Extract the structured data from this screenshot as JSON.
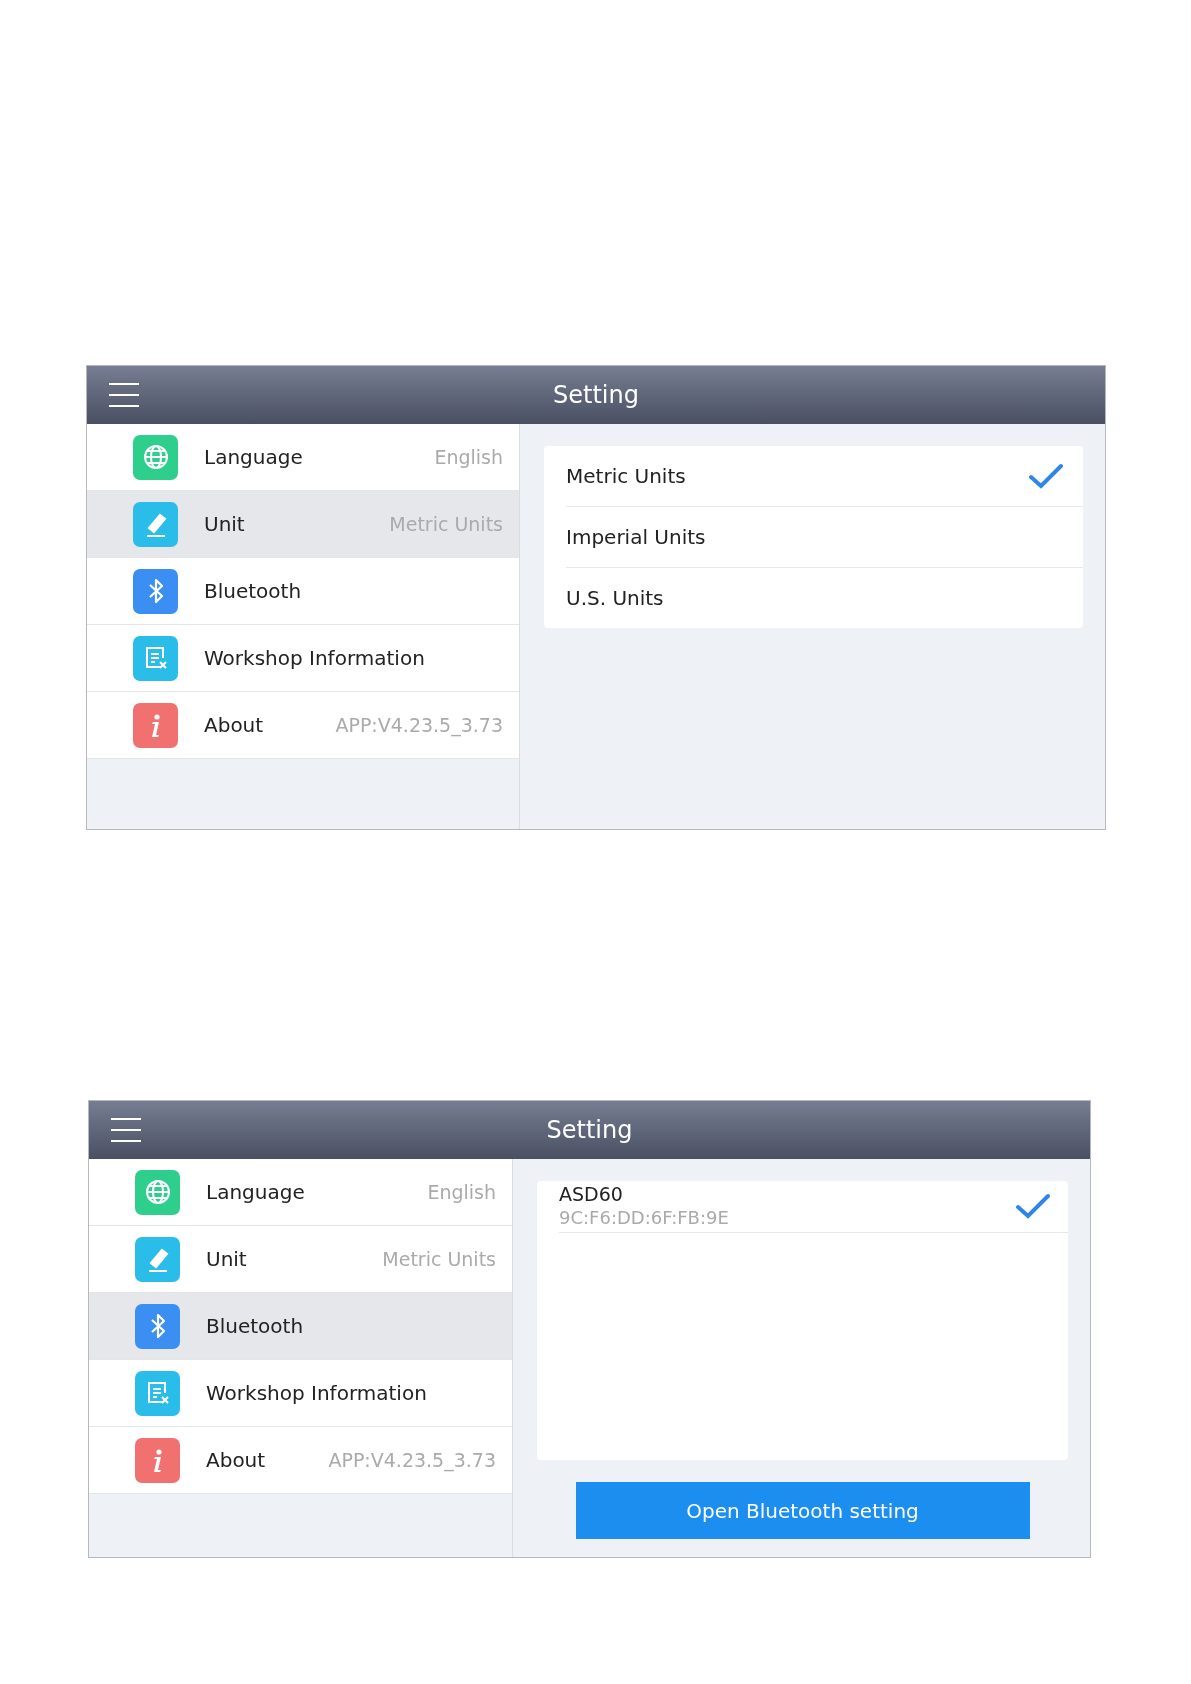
{
  "screens": [
    {
      "title": "Setting",
      "menu": [
        {
          "kind": "globe",
          "label": "Language",
          "value": "English",
          "selected": false
        },
        {
          "kind": "ruler",
          "label": "Unit",
          "value": "Metric Units",
          "selected": true
        },
        {
          "kind": "bluetooth",
          "label": "Bluetooth",
          "selected": false
        },
        {
          "kind": "form",
          "label": "Workshop Information",
          "selected": false
        },
        {
          "kind": "info",
          "label": "About",
          "value": "APP:V4.23.5_3.73",
          "selected": false
        }
      ],
      "detail": {
        "kind": "options",
        "options": [
          {
            "label": "Metric Units",
            "selected": true
          },
          {
            "label": "Imperial Units",
            "selected": false
          },
          {
            "label": "U.S. Units",
            "selected": false
          }
        ]
      }
    },
    {
      "title": "Setting",
      "menu": [
        {
          "kind": "globe",
          "label": "Language",
          "value": "English",
          "selected": false
        },
        {
          "kind": "ruler",
          "label": "Unit",
          "value": "Metric Units",
          "selected": false
        },
        {
          "kind": "bluetooth",
          "label": "Bluetooth",
          "selected": true
        },
        {
          "kind": "form",
          "label": "Workshop Information",
          "selected": false
        },
        {
          "kind": "info",
          "label": "About",
          "value": "APP:V4.23.5_3.73",
          "selected": false
        }
      ],
      "detail": {
        "kind": "devices",
        "devices": [
          {
            "name": "ASD60",
            "address": "9C:F6:DD:6F:FB:9E",
            "selected": true
          }
        ],
        "button": "Open Bluetooth setting"
      }
    }
  ]
}
